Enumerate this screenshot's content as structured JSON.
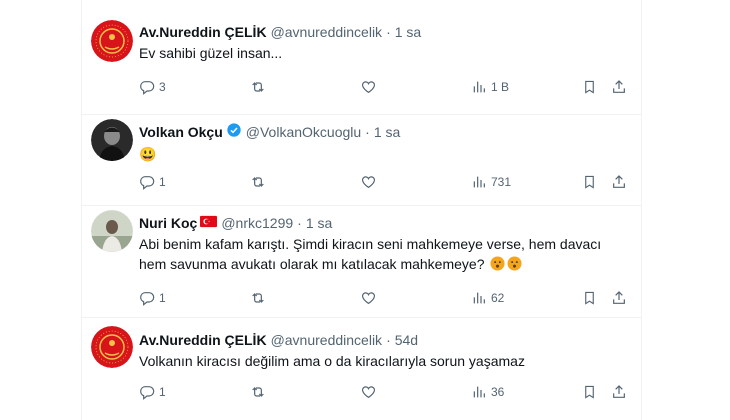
{
  "tweets": [
    {
      "name": "Av.Nureddin ÇELİK",
      "handle": "@avnureddincelik",
      "time": "1 sa",
      "text": "Ev sahibi güzel insan...",
      "replies": "3",
      "retweets": "",
      "likes": "",
      "views": "1 B"
    },
    {
      "name": "Volkan Okçu",
      "handle": "@VolkanOkcuoglu",
      "time": "1 sa",
      "text": "😃",
      "replies": "1",
      "retweets": "",
      "likes": "",
      "views": "731"
    },
    {
      "name": "Nuri Koç",
      "handle": "@nrkc1299",
      "time": "1 sa",
      "text": "Abi benim kafam karıştı. Şimdi kiracın seni mahkemeye verse, hem davacı hem savunma avukatı olarak mı katılacak mahkemeye?",
      "replies": "1",
      "retweets": "",
      "likes": "",
      "views": "62"
    },
    {
      "name": "Av.Nureddin ÇELİK",
      "handle": "@avnureddincelik",
      "time": "54d",
      "text": "Volkanın kiracısı değilim ama o da kiracılarıyla sorun yaşamaz",
      "replies": "1",
      "retweets": "",
      "likes": "",
      "views": "36"
    }
  ],
  "colors": {
    "text": "#0f1419",
    "secondary": "#536471",
    "verified": "#1d9bf0",
    "divider": "#eff3f4",
    "flag_red": "#e30a17"
  },
  "separator": "·"
}
